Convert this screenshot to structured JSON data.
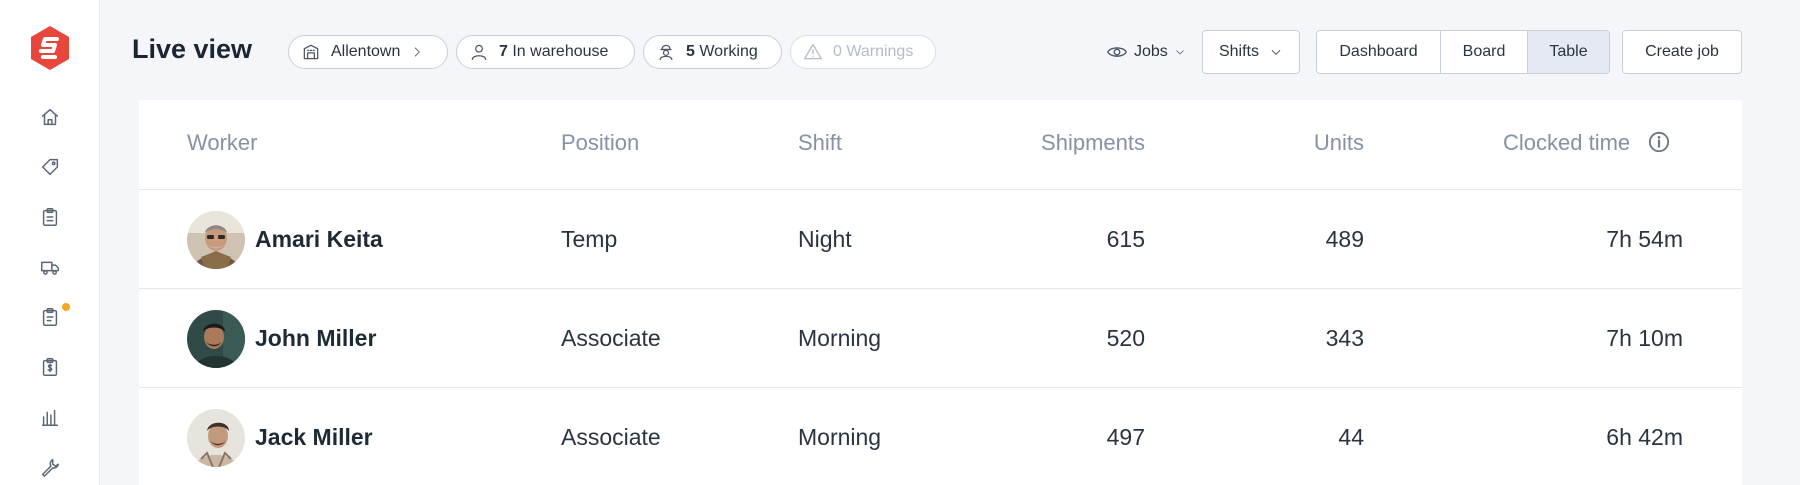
{
  "sidebar": {
    "items": [
      {
        "icon": "home-icon"
      },
      {
        "icon": "tag-icon"
      },
      {
        "icon": "clipboard-icon"
      },
      {
        "icon": "truck-icon"
      },
      {
        "icon": "clipboard-list-icon",
        "badge_color": "#f5a623"
      },
      {
        "icon": "invoice-icon"
      },
      {
        "icon": "bar-chart-icon"
      },
      {
        "icon": "wrench-icon"
      }
    ],
    "brand_color": "#e8453c"
  },
  "header": {
    "title": "Live view",
    "location": "Allentown",
    "in_warehouse_count": "7",
    "in_warehouse_label": "In warehouse",
    "working_count": "5",
    "working_label": "Working",
    "warnings_label": "0 Warnings",
    "jobs_label": "Jobs",
    "shifts_label": "Shifts",
    "views": [
      "Dashboard",
      "Board",
      "Table"
    ],
    "active_view": "Table",
    "create_label": "Create job"
  },
  "table": {
    "columns": [
      "Worker",
      "Position",
      "Shift",
      "Shipments",
      "Units",
      "Clocked time"
    ],
    "rows": [
      {
        "worker": "Amari Keita",
        "position": "Temp",
        "shift": "Night",
        "shipments": "615",
        "units": "489",
        "clocked": "7h 54m"
      },
      {
        "worker": "John Miller",
        "position": "Associate",
        "shift": "Morning",
        "shipments": "520",
        "units": "343",
        "clocked": "7h 10m"
      },
      {
        "worker": "Jack Miller",
        "position": "Associate",
        "shift": "Morning",
        "shipments": "497",
        "units": "44",
        "clocked": "6h 42m"
      }
    ]
  }
}
